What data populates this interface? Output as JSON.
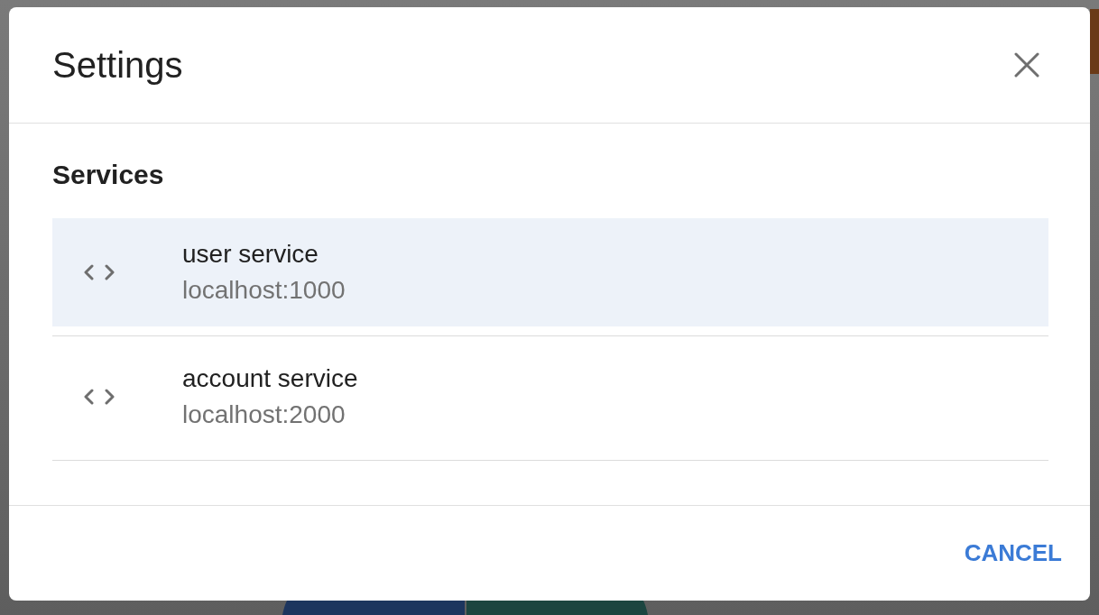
{
  "dialog": {
    "title": "Settings",
    "section_title": "Services",
    "services": [
      {
        "name": "user service",
        "address": "localhost:1000",
        "selected": true
      },
      {
        "name": "account service",
        "address": "localhost:2000",
        "selected": false
      }
    ],
    "buttons": [
      "CANCEL"
    ]
  }
}
